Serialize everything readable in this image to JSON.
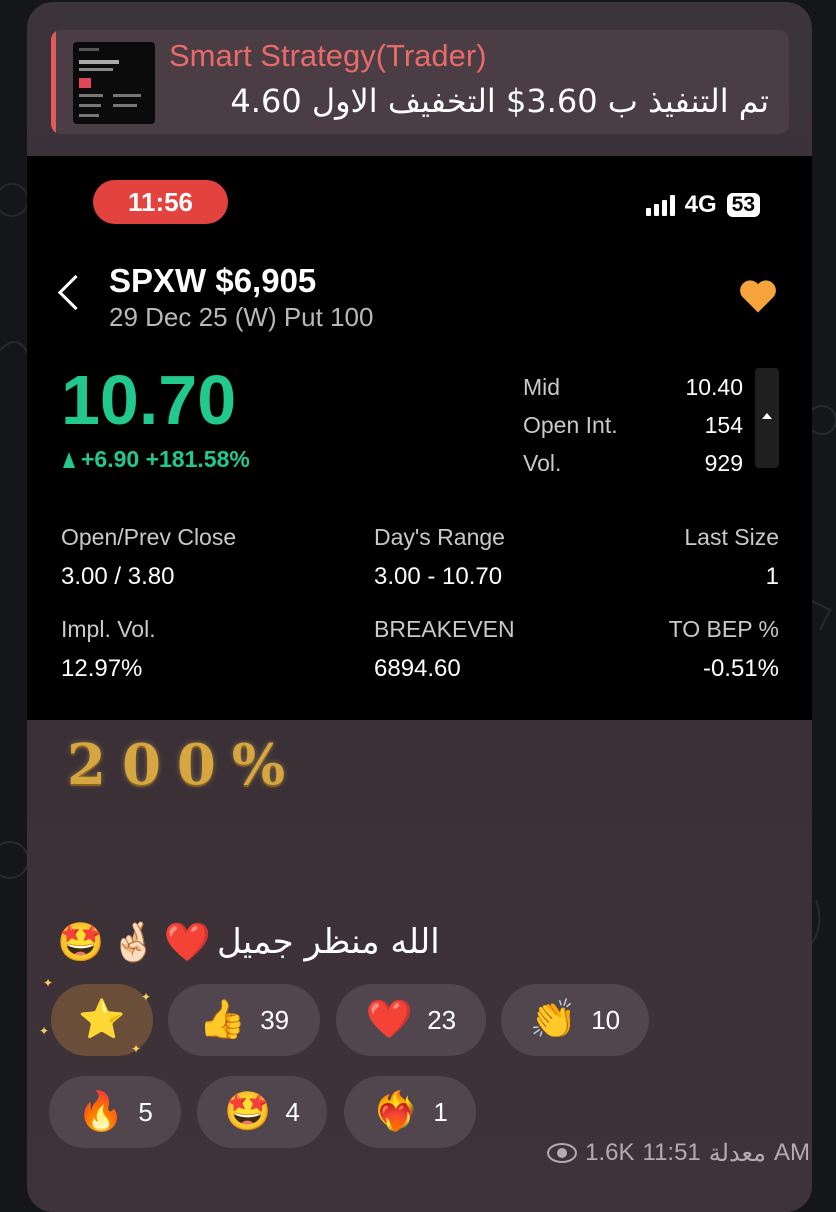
{
  "colors": {
    "accent_red": "#e45a5a",
    "price_green": "#22c98f",
    "gold": "#d6a640",
    "bubble_bg": "#3b343a"
  },
  "reply": {
    "title": "Smart Strategy(Trader)",
    "text": "تم التنفيذ ب 3.60$ التخفيف الاول 4.60"
  },
  "phone": {
    "time": "11:56",
    "network": "4G",
    "battery": "53",
    "ticker": "SPXW $6,905",
    "subtitle": "29 Dec 25 (W) Put 100",
    "favorite_icon": "heart-icon",
    "price": "10.70",
    "change": "+6.90 +181.58%",
    "side": [
      {
        "label": "Mid",
        "value": "10.40"
      },
      {
        "label": "Open Int.",
        "value": "154"
      },
      {
        "label": "Vol.",
        "value": "929"
      }
    ],
    "stats": {
      "open_prev_close": {
        "label": "Open/Prev Close",
        "value": "3.00 / 3.80"
      },
      "days_range": {
        "label": "Day's Range",
        "value": "3.00 - 10.70"
      },
      "last_size": {
        "label": "Last Size",
        "value": "1"
      },
      "impl_vol": {
        "label": "Impl. Vol.",
        "value": "12.97%"
      },
      "breakeven": {
        "label": "BREAKEVEN",
        "value": "6894.60"
      },
      "to_bep": {
        "label": "TO BEP %",
        "value": "-0.51%"
      }
    }
  },
  "caption": {
    "percent": "200%",
    "message": "الله منظر جميل",
    "emojis": [
      "❤️",
      "🤞🏻",
      "🤩"
    ]
  },
  "reactions": [
    {
      "emoji": "⭐",
      "count": ""
    },
    {
      "emoji": "👍",
      "count": "39"
    },
    {
      "emoji": "❤️",
      "count": "23"
    },
    {
      "emoji": "👏",
      "count": "10"
    },
    {
      "emoji": "🔥",
      "count": "5"
    },
    {
      "emoji": "🤩",
      "count": "4"
    },
    {
      "emoji": "❤️‍🔥",
      "count": "1"
    }
  ],
  "footer": {
    "views": "1.6K",
    "time": "11:51",
    "edited": "معدلة",
    "ampm": "AM"
  }
}
